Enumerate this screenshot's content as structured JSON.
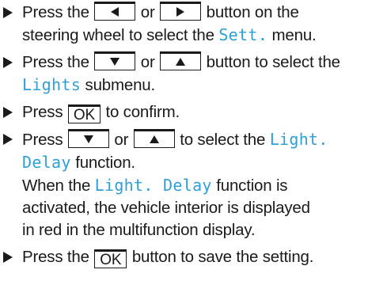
{
  "steps": [
    {
      "l1_a": "Press the",
      "l1_b": "or",
      "l1_c": "button on the",
      "l2_a": "steering wheel to select the",
      "l2_menu": "Sett.",
      "l2_b": "menu."
    },
    {
      "l1_a": "Press the",
      "l1_b": "or",
      "l1_c": "button to select the",
      "l2_menu": "Lights",
      "l2_b": "submenu."
    },
    {
      "l1_a": "Press",
      "l1_key": "OK",
      "l1_b": "to confirm."
    },
    {
      "l1_a": "Press",
      "l1_b": "or",
      "l1_c": "to select the",
      "l1_menu": "Light.",
      "l2_menu": "Delay",
      "l2_b": "function.",
      "l3_a": "When the",
      "l3_menu": "Light. Delay",
      "l3_b": "function is",
      "l4": "activated, the vehicle interior is displayed",
      "l5": "in red in the multifunction display."
    },
    {
      "l1_a": "Press the",
      "l1_key": "OK",
      "l1_b": "button to save the setting."
    }
  ],
  "icons": {
    "bullet": "triangle-right-bullet-icon",
    "left": "triangle-left-icon",
    "right": "triangle-right-icon",
    "down": "triangle-down-icon",
    "up": "triangle-up-icon"
  }
}
